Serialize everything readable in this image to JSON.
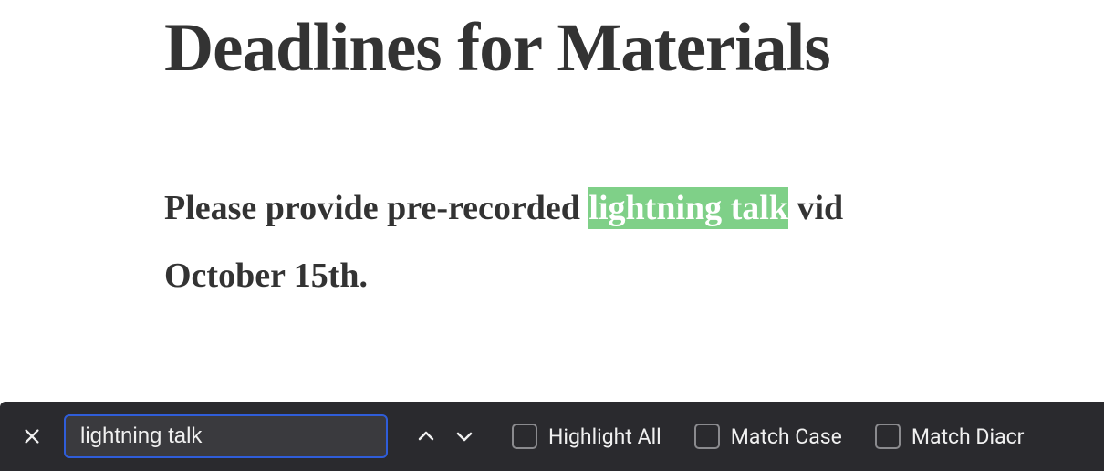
{
  "content": {
    "heading": "Deadlines for Materials",
    "paragraph_before": "Please provide pre-recorded ",
    "paragraph_highlight": "lightning talk",
    "paragraph_after": " vid",
    "paragraph_line2": "October 15th."
  },
  "findbar": {
    "search_value": "lightning talk",
    "highlight_all_label": "Highlight All",
    "match_case_label": "Match Case",
    "match_diacritics_label": "Match Diacr"
  }
}
